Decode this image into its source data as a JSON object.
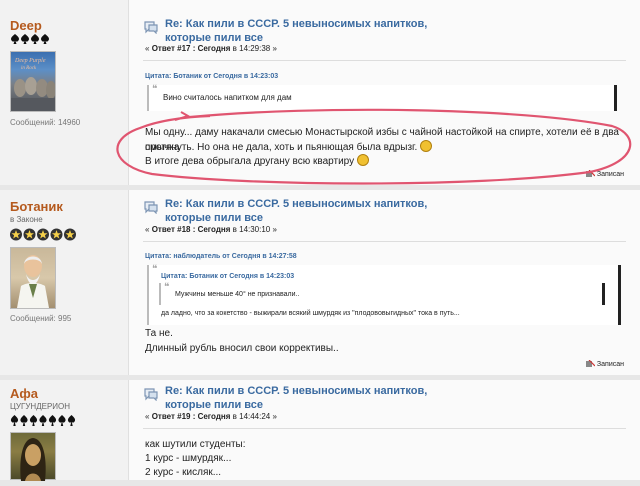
{
  "posts": [
    {
      "author": "Deep",
      "group": "",
      "posts_count": "Сообщений: 14960",
      "avatar_text": "Deep Purple in Rock",
      "title_line1": "Re: Как пили в СССР. 5 невыносимых напитков,",
      "title_line2": "которые пили все",
      "meta_prefix": "«",
      "meta_reply": "Ответ #17 : Сегодня",
      "meta_time": "в 14:29:38 »",
      "quote_header": "Цитата: Ботаник от Сегодня в 14:23:03",
      "quote_text": "Вино считалось напитком для дам",
      "text_line1": "Мы одну... даму накачали смесью Монастырской избы с чайной настойкой на спирте, хотели её в два смычка",
      "text_line2": "протянуть. Но она не дала, хоть и пьянющая была вдрызг.",
      "text_line3": "В итоге дева обрыгала другану всю квартиру",
      "record_label": "Записан"
    },
    {
      "author": "Ботаник",
      "group": "в Законе",
      "posts_count": "Сообщений: 995",
      "title_line1": "Re: Как пили в СССР. 5 невыносимых напитков,",
      "title_line2": "которые пили все",
      "meta_prefix": "«",
      "meta_reply": "Ответ #18 : Сегодня",
      "meta_time": "в 14:30:10 »",
      "quote_header": "Цитата: наблюдатель от Сегодня в 14:27:58",
      "inner_quote_header": "Цитата: Ботаник от Сегодня в 14:23:03",
      "inner_quote_text": "Мужчины меньше 40° не признавали..",
      "quote_text": "да ладно, что за кокетство - выжирали всякий шмурдяк из \"плодововыгидных\" тока в путь...",
      "text_line1": "Та не.",
      "text_line2": "Длинный рубль вносил свои коррективы..",
      "record_label": "Записан"
    },
    {
      "author": "Афа",
      "group": "ЦУГУНДЕРИОН",
      "title_line1": "Re: Как пили в СССР. 5 невыносимых напитков,",
      "title_line2": "которые пили все",
      "meta_prefix": "«",
      "meta_reply": "Ответ #19 : Сегодня",
      "meta_time": "в 14:44:24 »",
      "text_line1": "как шутили студенты:",
      "text_line2": "1 курс - шмурдяк...",
      "text_line3": "2 курс - кисляк..."
    }
  ],
  "colors": {
    "author": "#b55a1e",
    "title": "#3a6aa0",
    "annotation": "#e05570"
  }
}
